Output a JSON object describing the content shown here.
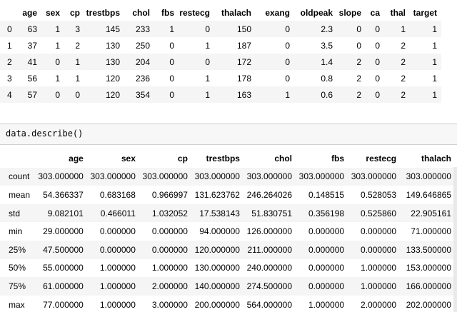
{
  "head": {
    "columns": [
      "age",
      "sex",
      "cp",
      "trestbps",
      "chol",
      "fbs",
      "restecg",
      "thalach",
      "exang",
      "oldpeak",
      "slope",
      "ca",
      "thal",
      "target"
    ],
    "rows": [
      {
        "index": "0",
        "values": [
          "63",
          "1",
          "3",
          "145",
          "233",
          "1",
          "0",
          "150",
          "0",
          "2.3",
          "0",
          "0",
          "1",
          "1"
        ]
      },
      {
        "index": "1",
        "values": [
          "37",
          "1",
          "2",
          "130",
          "250",
          "0",
          "1",
          "187",
          "0",
          "3.5",
          "0",
          "0",
          "2",
          "1"
        ]
      },
      {
        "index": "2",
        "values": [
          "41",
          "0",
          "1",
          "130",
          "204",
          "0",
          "0",
          "172",
          "0",
          "1.4",
          "2",
          "0",
          "2",
          "1"
        ]
      },
      {
        "index": "3",
        "values": [
          "56",
          "1",
          "1",
          "120",
          "236",
          "0",
          "1",
          "178",
          "0",
          "0.8",
          "2",
          "0",
          "2",
          "1"
        ]
      },
      {
        "index": "4",
        "values": [
          "57",
          "0",
          "0",
          "120",
          "354",
          "0",
          "1",
          "163",
          "1",
          "0.6",
          "2",
          "0",
          "2",
          "1"
        ]
      }
    ]
  },
  "input_cell": {
    "code": "data.describe()"
  },
  "describe": {
    "columns": [
      "age",
      "sex",
      "cp",
      "trestbps",
      "chol",
      "fbs",
      "restecg",
      "thalach"
    ],
    "rows": [
      {
        "label": "count",
        "values": [
          "303.000000",
          "303.000000",
          "303.000000",
          "303.000000",
          "303.000000",
          "303.000000",
          "303.000000",
          "303.000000"
        ]
      },
      {
        "label": "mean",
        "values": [
          "54.366337",
          "0.683168",
          "0.966997",
          "131.623762",
          "246.264026",
          "0.148515",
          "0.528053",
          "149.646865"
        ]
      },
      {
        "label": "std",
        "values": [
          "9.082101",
          "0.466011",
          "1.032052",
          "17.538143",
          "51.830751",
          "0.356198",
          "0.525860",
          "22.905161"
        ]
      },
      {
        "label": "min",
        "values": [
          "29.000000",
          "0.000000",
          "0.000000",
          "94.000000",
          "126.000000",
          "0.000000",
          "0.000000",
          "71.000000"
        ]
      },
      {
        "label": "25%",
        "values": [
          "47.500000",
          "0.000000",
          "0.000000",
          "120.000000",
          "211.000000",
          "0.000000",
          "0.000000",
          "133.500000"
        ]
      },
      {
        "label": "50%",
        "values": [
          "55.000000",
          "1.000000",
          "1.000000",
          "130.000000",
          "240.000000",
          "0.000000",
          "1.000000",
          "153.000000"
        ]
      },
      {
        "label": "75%",
        "values": [
          "61.000000",
          "1.000000",
          "2.000000",
          "140.000000",
          "274.500000",
          "0.000000",
          "1.000000",
          "166.000000"
        ]
      },
      {
        "label": "max",
        "values": [
          "77.000000",
          "1.000000",
          "3.000000",
          "200.000000",
          "564.000000",
          "1.000000",
          "2.000000",
          "202.000000"
        ]
      }
    ]
  }
}
